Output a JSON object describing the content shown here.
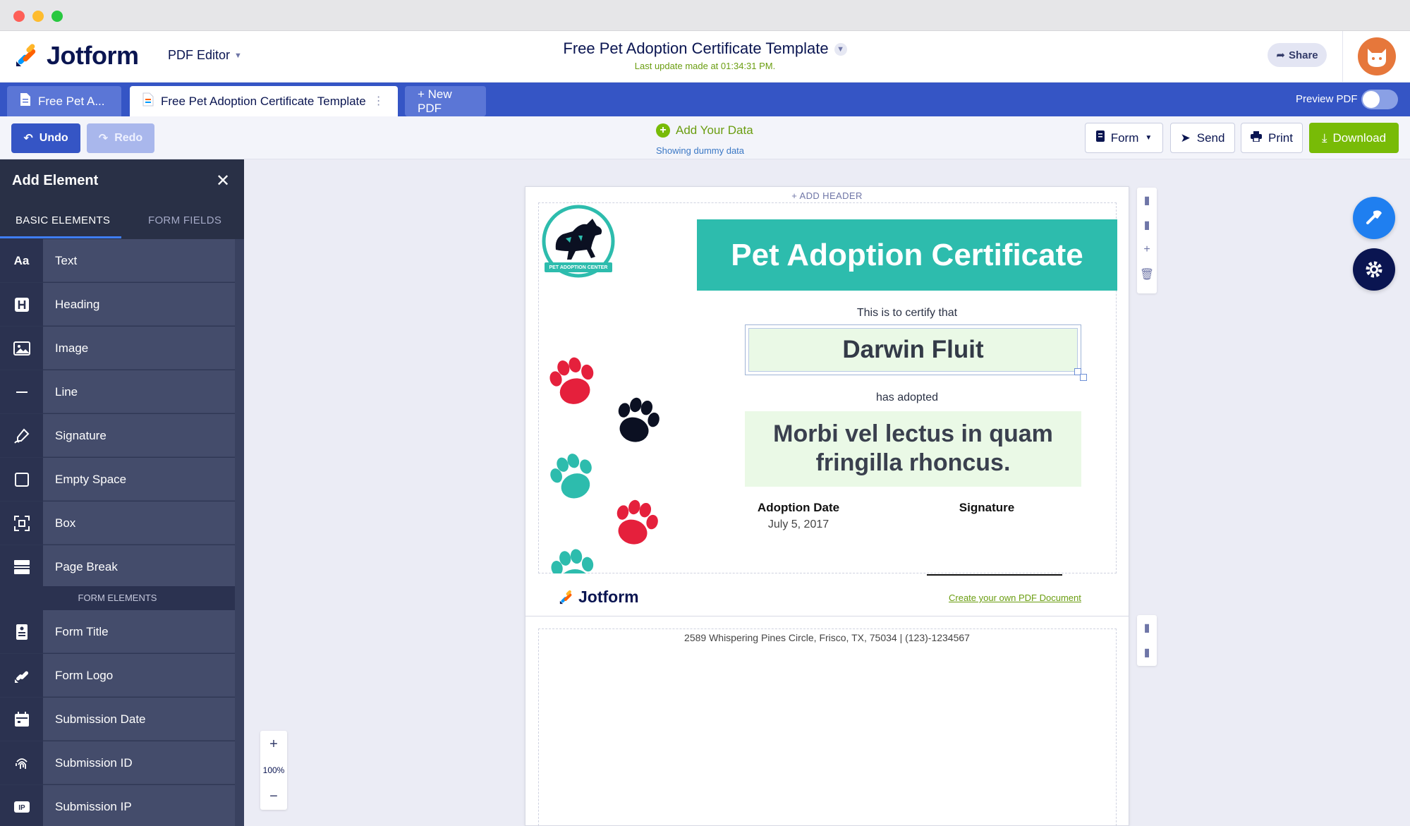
{
  "app": {
    "brand": "Jotform",
    "mode_label": "PDF Editor",
    "doc_title": "Free Pet Adoption Certificate Template",
    "last_update": "Last update made at 01:34:31 PM.",
    "share_label": "Share"
  },
  "tabs": [
    {
      "label": "Free Pet A..."
    },
    {
      "label": "Free Pet Adoption Certificate Template"
    },
    {
      "label": "+ New PDF"
    }
  ],
  "preview_label": "Preview PDF",
  "toolbar": {
    "undo": "Undo",
    "redo": "Redo",
    "add_data": "Add Your Data",
    "dummy_note": "Showing dummy data",
    "form": "Form",
    "send": "Send",
    "print": "Print",
    "download": "Download"
  },
  "sidebar": {
    "title": "Add Element",
    "tab_basic": "BASIC ELEMENTS",
    "tab_fields": "FORM FIELDS",
    "basic": [
      {
        "label": "Text",
        "icon": "text-icon"
      },
      {
        "label": "Heading",
        "icon": "heading-icon"
      },
      {
        "label": "Image",
        "icon": "image-icon"
      },
      {
        "label": "Line",
        "icon": "line-icon"
      },
      {
        "label": "Signature",
        "icon": "signature-icon"
      },
      {
        "label": "Empty Space",
        "icon": "empty-space-icon"
      },
      {
        "label": "Box",
        "icon": "box-icon"
      },
      {
        "label": "Page Break",
        "icon": "page-break-icon"
      }
    ],
    "section_label": "FORM ELEMENTS",
    "form": [
      {
        "label": "Form Title",
        "icon": "form-title-icon"
      },
      {
        "label": "Form Logo",
        "icon": "form-logo-icon"
      },
      {
        "label": "Submission Date",
        "icon": "calendar-icon"
      },
      {
        "label": "Submission ID",
        "icon": "fingerprint-icon"
      },
      {
        "label": "Submission IP",
        "icon": "ip-icon"
      }
    ]
  },
  "zoom": {
    "plus": "+",
    "value": "100%",
    "minus": "−"
  },
  "page": {
    "add_header": "+ ADD HEADER",
    "logo_text": "PET ADOPTION CENTER",
    "banner": "Pet Adoption Certificate",
    "certify": "This is to certify that",
    "name": "Darwin Fluit",
    "adopted": "has adopted",
    "pet": "Morbi vel lectus in quam fringilla rhoncus.",
    "date_label": "Adoption Date",
    "date_value": "July 5, 2017",
    "signature_label": "Signature",
    "footer_brand": "Jotform",
    "footer_link": "Create your own PDF Document",
    "address": "2589 Whispering Pines Circle, Frisco, TX, 75034 | (123)-1234567"
  },
  "colors": {
    "brand_blue": "#3555c5",
    "accent_green": "#78bb07",
    "banner_teal": "#2dbcad",
    "paw_red": "#e5203c",
    "paw_black": "#0b1022"
  }
}
